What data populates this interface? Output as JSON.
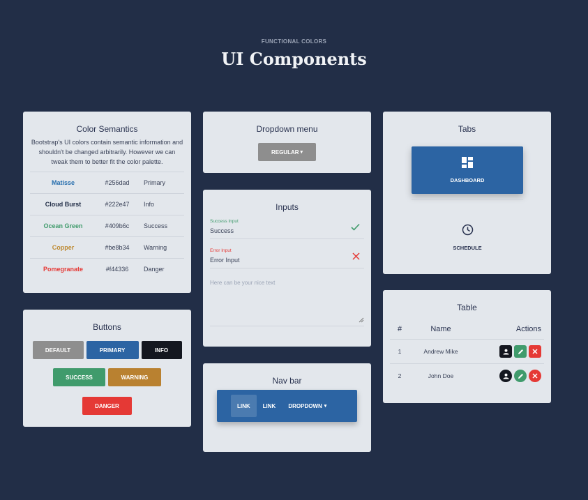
{
  "header": {
    "eyebrow": "FUNCTIONAL COLORS",
    "title": "UI Components"
  },
  "colors_card": {
    "title": "Color Semantics",
    "description": "Bootstrap's UI colors contain semantic information and shouldn't be changed arbitrarily. However we can tweak them to better fit the color palette.",
    "rows": [
      {
        "name": "Matisse",
        "hex": "#256dad",
        "semantic": "Primary",
        "color": "#256dad"
      },
      {
        "name": "Cloud Burst",
        "hex": "#222e47",
        "semantic": "Info",
        "color": "#222e47"
      },
      {
        "name": "Ocean Green",
        "hex": "#409b6c",
        "semantic": "Success",
        "color": "#409b6c"
      },
      {
        "name": "Copper",
        "hex": "#be8b34",
        "semantic": "Warning",
        "color": "#be8b34"
      },
      {
        "name": "Pomegranate",
        "hex": "#f44336",
        "semantic": "Danger",
        "color": "#f44336"
      }
    ]
  },
  "buttons_card": {
    "title": "Buttons",
    "default": {
      "label": "DEFAULT",
      "color": "#8e8e8e"
    },
    "primary": {
      "label": "PRIMARY",
      "color": "#2c64a3"
    },
    "info": {
      "label": "INFO",
      "color": "#14171f"
    },
    "success": {
      "label": "SUCCESS",
      "color": "#409b6c"
    },
    "warning": {
      "label": "WARNING",
      "color": "#b98130"
    },
    "danger": {
      "label": "DANGER",
      "color": "#e53935"
    }
  },
  "dropdown_card": {
    "title": "Dropdown menu",
    "button_label": "REGULAR",
    "caret": "▾"
  },
  "inputs_card": {
    "title": "Inputs",
    "success": {
      "label": "Success Input",
      "value": "Success",
      "icon": "check-icon",
      "color": "#409b6c"
    },
    "error": {
      "label": "Error Input",
      "value": "Error Input",
      "icon": "close-icon",
      "color": "#e53935"
    },
    "textarea_placeholder": "Here can be your nice text"
  },
  "navbar_card": {
    "title": "Nav bar",
    "items": [
      {
        "label": "LINK",
        "active": true
      },
      {
        "label": "LINK",
        "active": false
      },
      {
        "label": "DROPDOWN",
        "active": false
      }
    ],
    "caret": "▾"
  },
  "tabs_card": {
    "title": "Tabs",
    "tabs": [
      {
        "label": "DASHBOARD",
        "icon": "dashboard-icon",
        "active": true
      },
      {
        "label": "SCHEDULE",
        "icon": "clock-icon",
        "active": false
      }
    ]
  },
  "table_card": {
    "title": "Table",
    "columns": [
      "#",
      "Name",
      "Actions"
    ],
    "rows": [
      {
        "num": "1",
        "name": "Andrew Mike"
      },
      {
        "num": "2",
        "name": "John Doe"
      }
    ],
    "action_icons": [
      "user-icon",
      "edit-icon",
      "delete-icon"
    ],
    "action_colors": {
      "user": "#14171f",
      "edit": "#409b6c",
      "delete": "#e53935"
    }
  }
}
